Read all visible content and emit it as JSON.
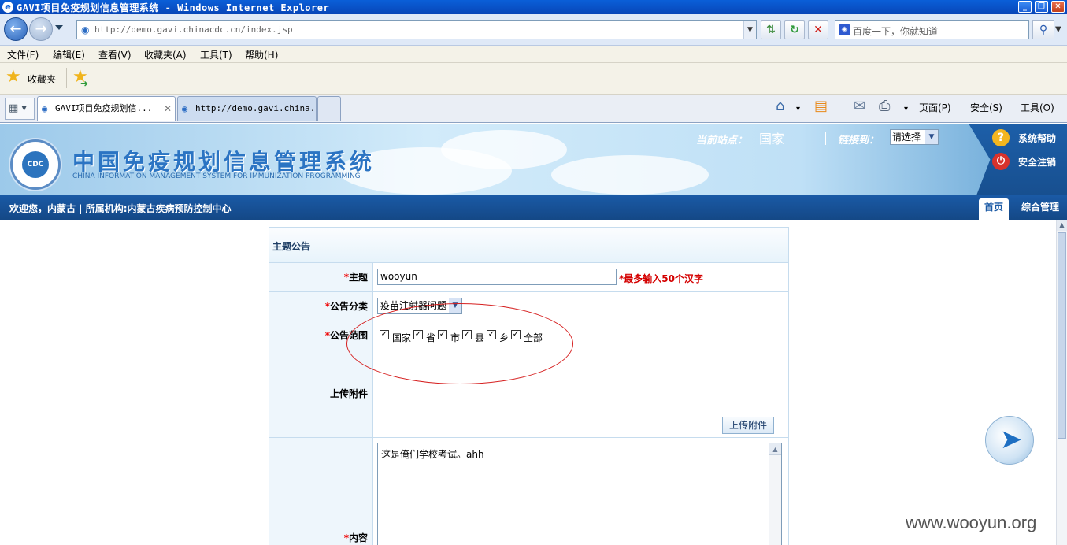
{
  "window": {
    "title": "GAVI项目免疫规划信息管理系统 - Windows Internet Explorer",
    "minimize": "_",
    "maximize": "❐",
    "close": "✕"
  },
  "address_bar": {
    "url": "http://demo.gavi.chinacdc.cn/index.jsp",
    "search_placeholder": "百度一下，你就知道"
  },
  "menu": {
    "file": "文件(F)",
    "edit": "编辑(E)",
    "view": "查看(V)",
    "favorites": "收藏夹(A)",
    "tools": "工具(T)",
    "help": "帮助(H)"
  },
  "favorites_bar": {
    "label": "收藏夹"
  },
  "tabs": [
    {
      "label": "GAVI项目免疫规划信...",
      "active": true
    },
    {
      "label": "http://demo.gavi.china...",
      "active": false
    }
  ],
  "command_bar": {
    "page": "页面(P)",
    "safety": "安全(S)",
    "tools": "工具(O)"
  },
  "site_header": {
    "system_name": "中国免疫规划信息管理系统",
    "system_name_en": "CHINA INFORMATION MANAGEMENT SYSTEM FOR IMMUNIZATION PROGRAMMING",
    "logo_text": "CDC",
    "station_label": "当前站点：",
    "station_value": "国家",
    "link_label": "链接到：",
    "link_select": "请选择",
    "help": "系统帮助",
    "logout": "安全注销"
  },
  "welcome_bar": {
    "text": "欢迎您，内蒙古 | 所属机构:内蒙古疾病预防控制中心",
    "tab_home": "首页",
    "tab_manage": "综合管理"
  },
  "form": {
    "heading": "主题公告",
    "subject_label": "主题",
    "subject_value": "wooyun",
    "subject_hint": "*最多输入50个汉字",
    "category_label": "公告分类",
    "category_value": "疫苗注射器问题",
    "scope_label": "公告范围",
    "scope_options": [
      {
        "label": "国家",
        "checked": true
      },
      {
        "label": "省",
        "checked": true
      },
      {
        "label": "市",
        "checked": true
      },
      {
        "label": "县",
        "checked": true
      },
      {
        "label": "乡",
        "checked": true
      },
      {
        "label": "全部",
        "checked": true
      }
    ],
    "attachment_label": "上传附件",
    "upload_button": "上传附件",
    "content_label": "内容",
    "content_value": "这是俺们学校考试。ahh",
    "required_mark": "*"
  },
  "watermark": "www.wooyun.org"
}
